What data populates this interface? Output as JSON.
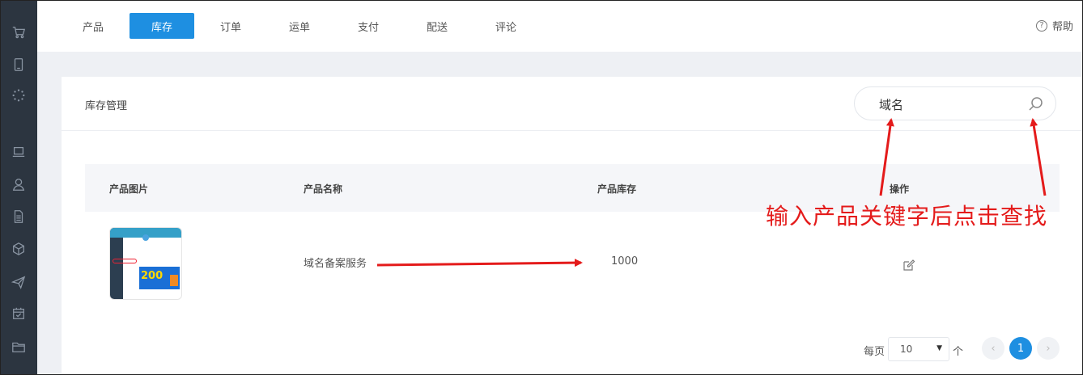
{
  "top_nav": {
    "tabs": [
      {
        "label": "产品",
        "active": false
      },
      {
        "label": "库存",
        "active": true
      },
      {
        "label": "订单",
        "active": false
      },
      {
        "label": "运单",
        "active": false
      },
      {
        "label": "支付",
        "active": false
      },
      {
        "label": "配送",
        "active": false
      },
      {
        "label": "评论",
        "active": false
      }
    ],
    "help_label": "帮助"
  },
  "sidebar": {
    "icons": [
      "cart-icon",
      "tablet-icon",
      "loading-icon",
      "laptop-icon",
      "user-icon",
      "document-icon",
      "box-icon",
      "send-icon",
      "calendar-check-icon",
      "folder-icon"
    ]
  },
  "card": {
    "title": "库存管理",
    "search": {
      "value": "域名"
    }
  },
  "table": {
    "columns": [
      "产品图片",
      "产品名称",
      "产品库存",
      "操作"
    ],
    "rows": [
      {
        "name": "域名备案服务",
        "stock": "1000",
        "thumb_badge": "200"
      }
    ]
  },
  "pagination": {
    "per_page_label": "每页",
    "per_page_value": "10",
    "unit_label": "个",
    "current_page": "1",
    "prev": "‹",
    "next": "›"
  },
  "annotation": {
    "text": "输入产品关键字后点击查找"
  },
  "colors": {
    "accent": "#1e8fe1",
    "sidebar": "#2c3540",
    "annotation": "#e41b1b"
  }
}
